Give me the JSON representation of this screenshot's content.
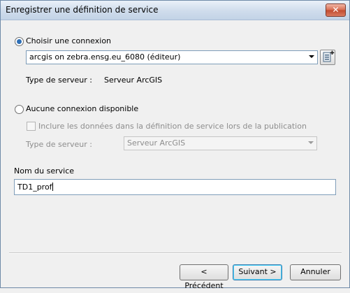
{
  "window": {
    "title": "Enregistrer une définition de service",
    "close_glyph": "✕"
  },
  "connection": {
    "choose_label": "Choisir une connexion",
    "selected": "arcgis on zebra.ensg.eu_6080 (éditeur)",
    "server_type_label": "Type de serveur :",
    "server_type_value": "Serveur ArcGIS"
  },
  "no_connection": {
    "label": "Aucune connexion disponible",
    "include_label": "Inclure les données dans la définition de service lors de la publication",
    "server_type_label": "Type de serveur :",
    "server_type_value": "Serveur ArcGIS"
  },
  "service_name": {
    "label": "Nom du service",
    "value": "TD1_prof"
  },
  "buttons": {
    "previous": "< Précédent",
    "next": "Suivant >",
    "cancel": "Annuler"
  },
  "icons": {
    "add_connection": "add-server-connection-icon"
  }
}
